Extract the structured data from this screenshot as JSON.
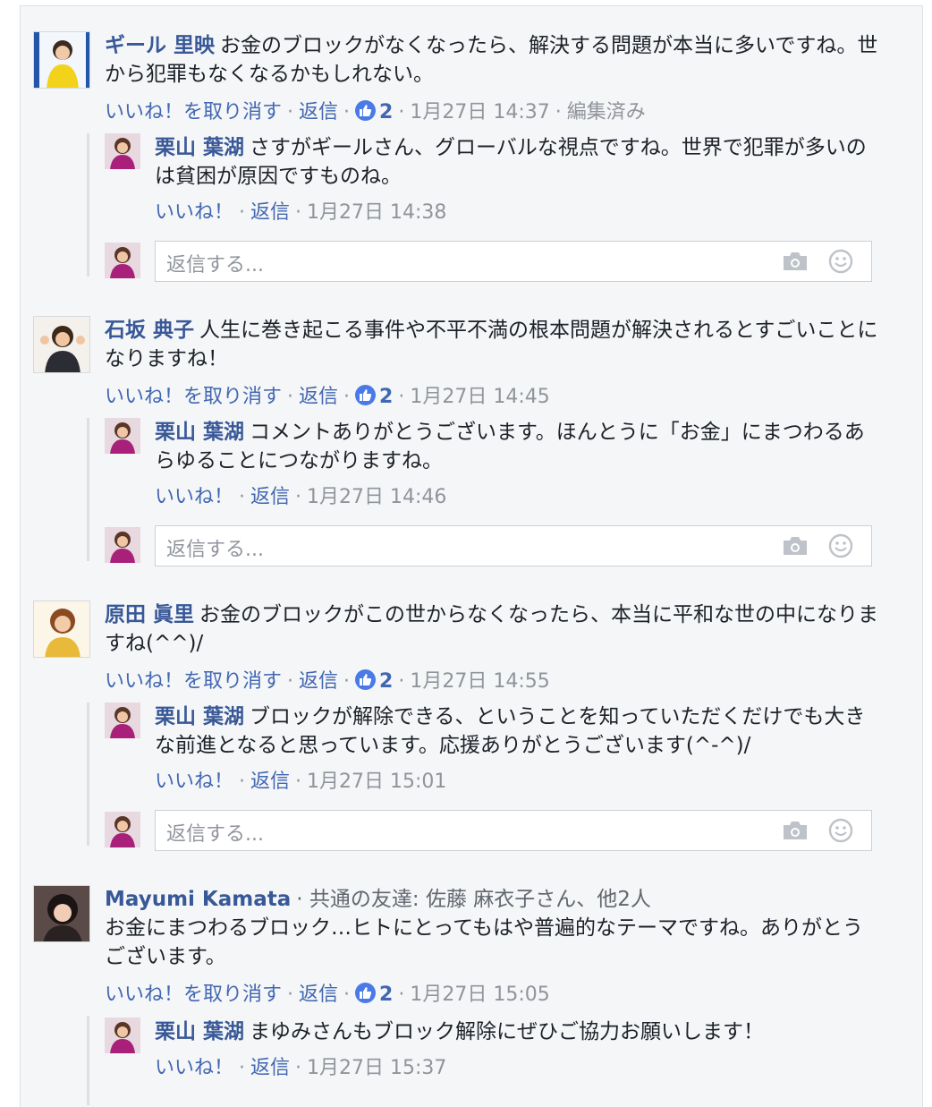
{
  "colors": {
    "link": "#4267b2",
    "author": "#385898",
    "meta": "#90949c",
    "like_badge": "#4a7ae8"
  },
  "comments": [
    {
      "author": "ギール 里映",
      "text": "お金のブロックがなくなったら、解決する問題が本当に多いですね。世から犯罪もなくなるかもしれない。",
      "unlike_label": "いいね！を取り消す",
      "reply_label": "返信",
      "like_count": "2",
      "time": "1月27日 14:37",
      "edited": "編集済み",
      "reply": {
        "author": "栗山 葉湖",
        "text": "さすがギールさん、グローバルな視点ですね。世界で犯罪が多いのは貧困が原因ですものね。",
        "like_label": "いいね！",
        "reply_label": "返信",
        "time": "1月27日 14:38"
      },
      "reply_placeholder": "返信する..."
    },
    {
      "author": "石坂 典子",
      "text": "人生に巻き起こる事件や不平不満の根本問題が解決されるとすごいことになりますね！",
      "unlike_label": "いいね！を取り消す",
      "reply_label": "返信",
      "like_count": "2",
      "time": "1月27日 14:45",
      "reply": {
        "author": "栗山 葉湖",
        "text": "コメントありがとうございます。ほんとうに「お金」にまつわるあらゆることにつながりますね。",
        "like_label": "いいね！",
        "reply_label": "返信",
        "time": "1月27日 14:46"
      },
      "reply_placeholder": "返信する..."
    },
    {
      "author": "原田 眞里",
      "text": "お金のブロックがこの世からなくなったら、本当に平和な世の中になりますね(^^)/",
      "unlike_label": "いいね！を取り消す",
      "reply_label": "返信",
      "like_count": "2",
      "time": "1月27日 14:55",
      "reply": {
        "author": "栗山 葉湖",
        "text": "ブロックが解除できる、ということを知っていただくだけでも大きな前進となると思っています。応援ありがとうございます(^-^)/",
        "like_label": "いいね！",
        "reply_label": "返信",
        "time": "1月27日 15:01"
      },
      "reply_placeholder": "返信する..."
    },
    {
      "author": "Mayumi Kamata",
      "mutual": "共通の友達: 佐藤 麻衣子さん、他2人",
      "text": "お金にまつわるブロック…ヒトにとってもはや普遍的なテーマですね。ありがとうございます。",
      "unlike_label": "いいね！を取り消す",
      "reply_label": "返信",
      "like_count": "2",
      "time": "1月27日 15:05",
      "reply": {
        "author": "栗山 葉湖",
        "text": "まゆみさんもブロック解除にぜひご協力お願いします！",
        "like_label": "いいね！",
        "reply_label": "返信",
        "time": "1月27日 15:37"
      }
    }
  ]
}
